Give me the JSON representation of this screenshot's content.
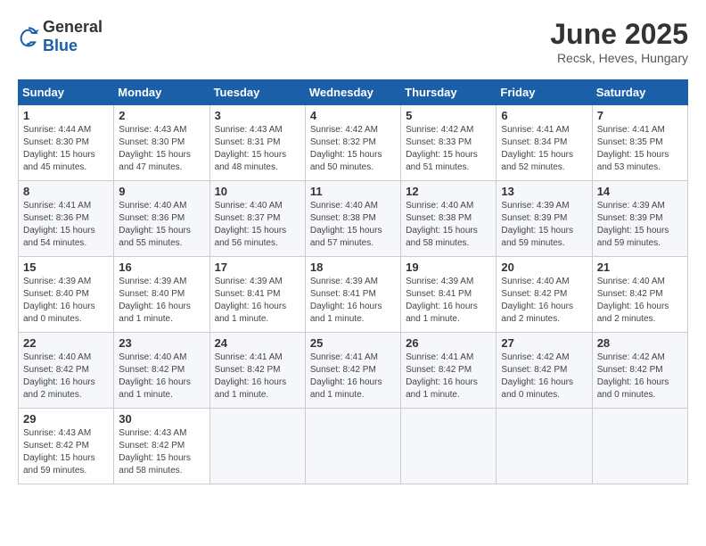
{
  "logo": {
    "general": "General",
    "blue": "Blue"
  },
  "title": "June 2025",
  "subtitle": "Recsk, Heves, Hungary",
  "days_of_week": [
    "Sunday",
    "Monday",
    "Tuesday",
    "Wednesday",
    "Thursday",
    "Friday",
    "Saturday"
  ],
  "weeks": [
    [
      {
        "day": "1",
        "info": "Sunrise: 4:44 AM\nSunset: 8:30 PM\nDaylight: 15 hours and 45 minutes."
      },
      {
        "day": "2",
        "info": "Sunrise: 4:43 AM\nSunset: 8:30 PM\nDaylight: 15 hours and 47 minutes."
      },
      {
        "day": "3",
        "info": "Sunrise: 4:43 AM\nSunset: 8:31 PM\nDaylight: 15 hours and 48 minutes."
      },
      {
        "day": "4",
        "info": "Sunrise: 4:42 AM\nSunset: 8:32 PM\nDaylight: 15 hours and 50 minutes."
      },
      {
        "day": "5",
        "info": "Sunrise: 4:42 AM\nSunset: 8:33 PM\nDaylight: 15 hours and 51 minutes."
      },
      {
        "day": "6",
        "info": "Sunrise: 4:41 AM\nSunset: 8:34 PM\nDaylight: 15 hours and 52 minutes."
      },
      {
        "day": "7",
        "info": "Sunrise: 4:41 AM\nSunset: 8:35 PM\nDaylight: 15 hours and 53 minutes."
      }
    ],
    [
      {
        "day": "8",
        "info": "Sunrise: 4:41 AM\nSunset: 8:36 PM\nDaylight: 15 hours and 54 minutes."
      },
      {
        "day": "9",
        "info": "Sunrise: 4:40 AM\nSunset: 8:36 PM\nDaylight: 15 hours and 55 minutes."
      },
      {
        "day": "10",
        "info": "Sunrise: 4:40 AM\nSunset: 8:37 PM\nDaylight: 15 hours and 56 minutes."
      },
      {
        "day": "11",
        "info": "Sunrise: 4:40 AM\nSunset: 8:38 PM\nDaylight: 15 hours and 57 minutes."
      },
      {
        "day": "12",
        "info": "Sunrise: 4:40 AM\nSunset: 8:38 PM\nDaylight: 15 hours and 58 minutes."
      },
      {
        "day": "13",
        "info": "Sunrise: 4:39 AM\nSunset: 8:39 PM\nDaylight: 15 hours and 59 minutes."
      },
      {
        "day": "14",
        "info": "Sunrise: 4:39 AM\nSunset: 8:39 PM\nDaylight: 15 hours and 59 minutes."
      }
    ],
    [
      {
        "day": "15",
        "info": "Sunrise: 4:39 AM\nSunset: 8:40 PM\nDaylight: 16 hours and 0 minutes."
      },
      {
        "day": "16",
        "info": "Sunrise: 4:39 AM\nSunset: 8:40 PM\nDaylight: 16 hours and 1 minute."
      },
      {
        "day": "17",
        "info": "Sunrise: 4:39 AM\nSunset: 8:41 PM\nDaylight: 16 hours and 1 minute."
      },
      {
        "day": "18",
        "info": "Sunrise: 4:39 AM\nSunset: 8:41 PM\nDaylight: 16 hours and 1 minute."
      },
      {
        "day": "19",
        "info": "Sunrise: 4:39 AM\nSunset: 8:41 PM\nDaylight: 16 hours and 1 minute."
      },
      {
        "day": "20",
        "info": "Sunrise: 4:40 AM\nSunset: 8:42 PM\nDaylight: 16 hours and 2 minutes."
      },
      {
        "day": "21",
        "info": "Sunrise: 4:40 AM\nSunset: 8:42 PM\nDaylight: 16 hours and 2 minutes."
      }
    ],
    [
      {
        "day": "22",
        "info": "Sunrise: 4:40 AM\nSunset: 8:42 PM\nDaylight: 16 hours and 2 minutes."
      },
      {
        "day": "23",
        "info": "Sunrise: 4:40 AM\nSunset: 8:42 PM\nDaylight: 16 hours and 1 minute."
      },
      {
        "day": "24",
        "info": "Sunrise: 4:41 AM\nSunset: 8:42 PM\nDaylight: 16 hours and 1 minute."
      },
      {
        "day": "25",
        "info": "Sunrise: 4:41 AM\nSunset: 8:42 PM\nDaylight: 16 hours and 1 minute."
      },
      {
        "day": "26",
        "info": "Sunrise: 4:41 AM\nSunset: 8:42 PM\nDaylight: 16 hours and 1 minute."
      },
      {
        "day": "27",
        "info": "Sunrise: 4:42 AM\nSunset: 8:42 PM\nDaylight: 16 hours and 0 minutes."
      },
      {
        "day": "28",
        "info": "Sunrise: 4:42 AM\nSunset: 8:42 PM\nDaylight: 16 hours and 0 minutes."
      }
    ],
    [
      {
        "day": "29",
        "info": "Sunrise: 4:43 AM\nSunset: 8:42 PM\nDaylight: 15 hours and 59 minutes."
      },
      {
        "day": "30",
        "info": "Sunrise: 4:43 AM\nSunset: 8:42 PM\nDaylight: 15 hours and 58 minutes."
      },
      null,
      null,
      null,
      null,
      null
    ]
  ]
}
